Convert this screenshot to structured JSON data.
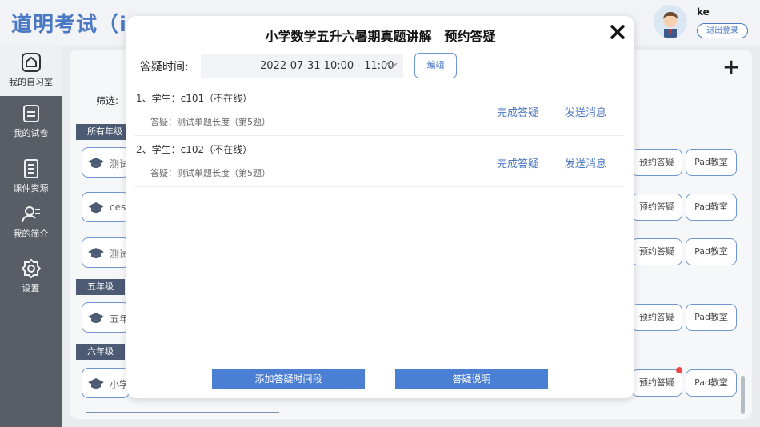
{
  "header": {
    "app_title": "道明考试（in",
    "user_name": "ke",
    "logout_label": "退出登录"
  },
  "sidebar": {
    "items": [
      {
        "label": "我的自习室",
        "icon": "home-icon",
        "active": true
      },
      {
        "label": "我的试卷",
        "icon": "paper-icon",
        "active": false
      },
      {
        "label": "课件资源",
        "icon": "document-icon",
        "active": false
      },
      {
        "label": "我的简介",
        "icon": "profile-icon",
        "active": false
      },
      {
        "label": "设置",
        "icon": "gear-icon",
        "active": false
      }
    ]
  },
  "main": {
    "filter_label": "筛选:",
    "grades": [
      "所有年级",
      "五年级",
      "六年级"
    ],
    "courses": [
      "测试",
      "cesh",
      "测试",
      "五年",
      "小学"
    ],
    "book_label": "预约答疑",
    "pad_label": "Pad教室"
  },
  "modal": {
    "title": "小学数学五升六暑期真题讲解　预约答疑",
    "time_label": "答疑时间:",
    "time_value": "2022-07-31 10:00 - 11:00",
    "edit_label": "编辑",
    "questions": [
      {
        "student": "1、学生：c101（不在线）",
        "detail": "答疑：测试单题长度（第5题）",
        "complete": "完成答疑",
        "message": "发送消息"
      },
      {
        "student": "2、学生：c102（不在线）",
        "detail": "答疑：测试单题长度（第5题）",
        "complete": "完成答疑",
        "message": "发送消息"
      }
    ],
    "add_slot_label": "添加答疑时间段",
    "instructions_label": "答疑说明"
  },
  "colors": {
    "accent": "#4a78c2",
    "sidebar": "#585d66",
    "grade_tag": "#4d5a74",
    "button_blue": "#4a7fd4"
  }
}
